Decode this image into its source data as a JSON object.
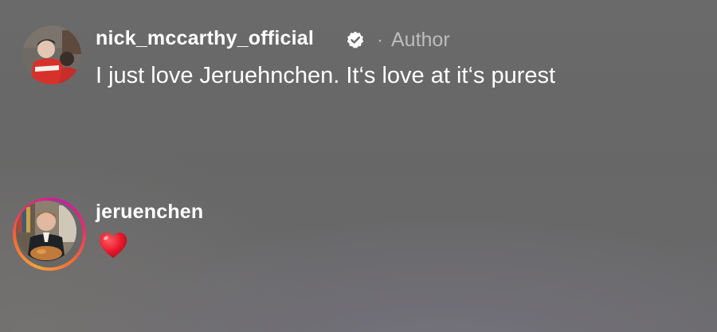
{
  "comments": [
    {
      "username": "nick_mccarthy_official",
      "verified": true,
      "separator": "·",
      "badge": "Author",
      "text": "I just love Jeruehnchen. It‘s love at it‘s purest",
      "avatar_icon": "profile-photo"
    },
    {
      "username": "jeruenchen",
      "has_story_ring": true,
      "reaction_icon": "red-heart-emoji",
      "avatar_icon": "profile-photo"
    }
  ],
  "colors": {
    "background": "#686868",
    "text": "#ffffff",
    "muted_text": "#bdbdbd",
    "heart": "#e8192c",
    "story_ring_start": "#f9a23a",
    "story_ring_end": "#c31ea3"
  }
}
